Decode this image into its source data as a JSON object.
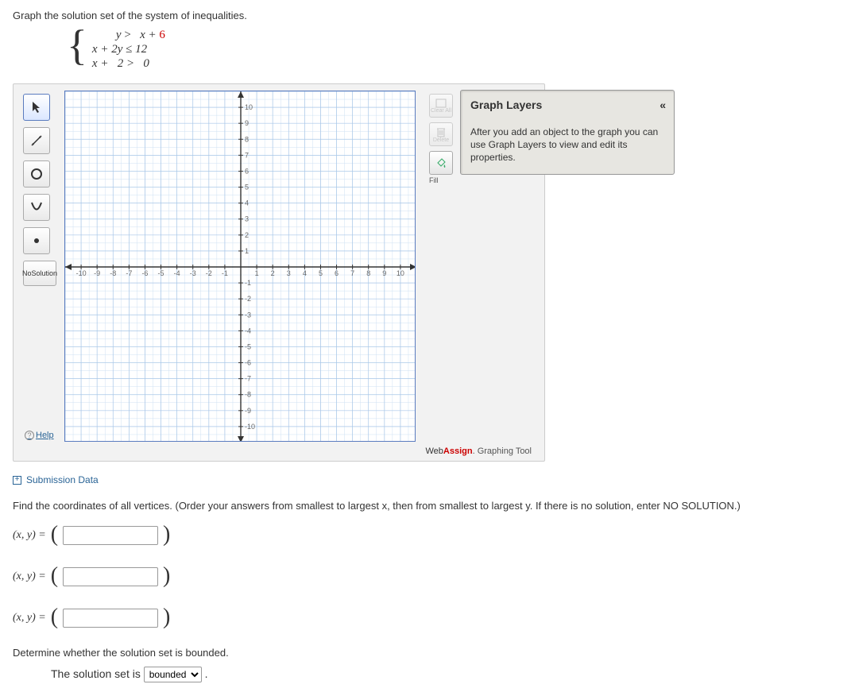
{
  "prompt": "Graph the solution set of the system of inequalities.",
  "system": {
    "eq1_lhs": "y",
    "eq1_op": ">",
    "eq1_rhs_a": "x + ",
    "eq1_rhs_b": "6",
    "eq2": "x + 2y ≤ 12",
    "eq3": "x +   2 >   0"
  },
  "toolbar": {
    "pointer": "pointer-tool",
    "line": "line-tool",
    "circle": "circle-tool",
    "parabola": "parabola-tool",
    "point": "point-tool",
    "nosol_l1": "No",
    "nosol_l2": "Solution"
  },
  "help_label": "Help",
  "actions": {
    "clear_label": "Clear All",
    "delete_label": "Delete",
    "fill_label": "Fill"
  },
  "brand_prefix": "Web",
  "brand_suffix": "Assign",
  "brand_tail": ". Graphing Tool",
  "layers": {
    "title": "Graph Layers",
    "body": "After you add an object to the graph you can use Graph Layers to view and edit its properties."
  },
  "submission_label": "Submission Data",
  "vertices_instr": "Find the coordinates of all vertices. (Order your answers from smallest to largest x, then from smallest to largest y. If there is no solution, enter NO SOLUTION.)",
  "xy_label": "(x, y) = ",
  "bounded_prompt": "Determine whether the solution set is bounded.",
  "bounded_lead": "The solution set is ",
  "bounded_selected": "bounded",
  "chart_data": {
    "type": "scatter",
    "title": "Empty coordinate grid",
    "x_ticks": [
      -10,
      -9,
      -8,
      -7,
      -6,
      -5,
      -4,
      -3,
      -2,
      -1,
      1,
      2,
      3,
      4,
      5,
      6,
      7,
      8,
      9,
      10
    ],
    "y_ticks": [
      -10,
      -9,
      -8,
      -7,
      -6,
      -5,
      -4,
      -3,
      -2,
      -1,
      1,
      2,
      3,
      4,
      5,
      6,
      7,
      8,
      9,
      10
    ],
    "xlim": [
      -11,
      11
    ],
    "ylim": [
      -11,
      11
    ],
    "series": []
  }
}
